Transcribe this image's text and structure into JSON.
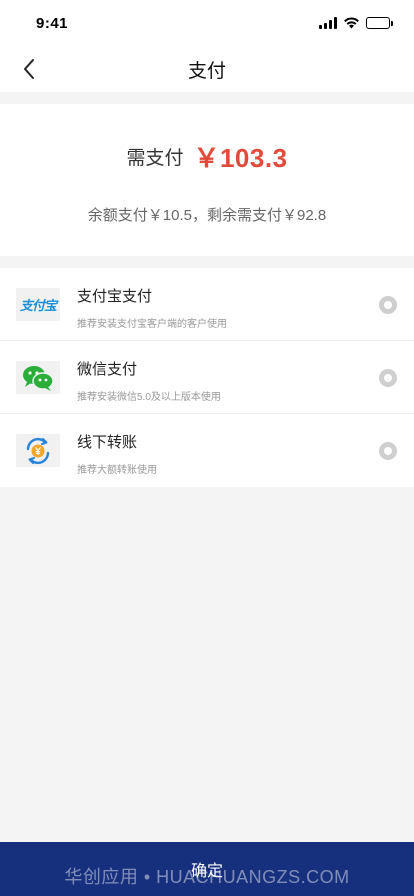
{
  "status_bar": {
    "time": "9:41",
    "icons": [
      "signal-icon",
      "wifi-icon",
      "battery-icon"
    ]
  },
  "nav": {
    "back_icon": "chevron-left-icon",
    "title": "支付"
  },
  "amount": {
    "label": "需支付",
    "value": "￥103.3",
    "breakdown": "余额支付￥10.5，剩余需支付￥92.8"
  },
  "methods": [
    {
      "icon": "alipay-logo",
      "logo_text": "支付宝",
      "name": "支付宝支付",
      "desc": "推荐安装支付宝客户端的客户使用",
      "selected": false
    },
    {
      "icon": "wechat-icon",
      "name": "微信支付",
      "desc": "推荐安装微信5.0及以上版本使用",
      "selected": false
    },
    {
      "icon": "bank-transfer-icon",
      "name": "线下转账",
      "desc": "推荐大额转账使用",
      "selected": false
    }
  ],
  "confirm": {
    "label": "确定"
  },
  "watermark": "华创应用 • HUACHUANGZS.COM",
  "colors": {
    "accent_red": "#e14b3b",
    "confirm_bg": "#16307e",
    "wechat_green": "#2aae3a",
    "alipay_blue": "#1a8fd6",
    "page_bg": "#f4f4f4"
  }
}
